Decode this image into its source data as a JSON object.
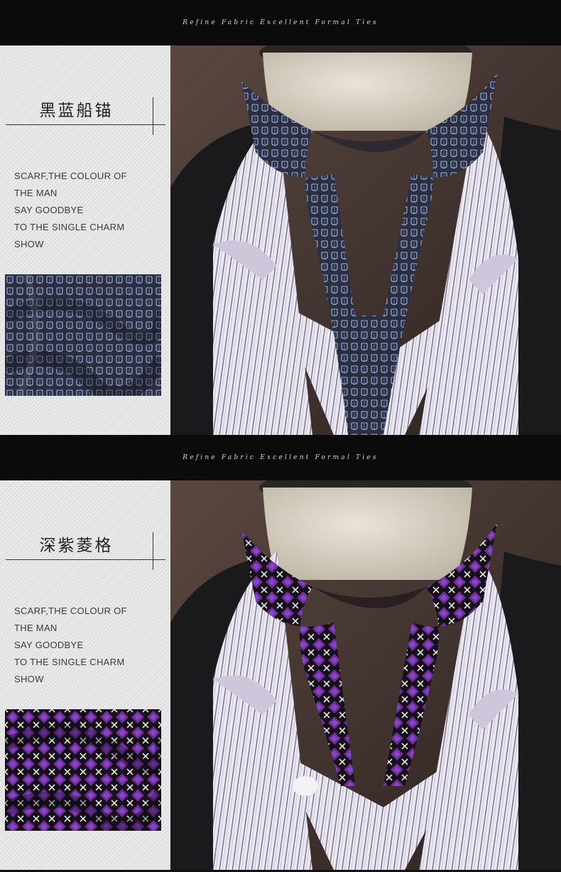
{
  "banner_tagline": "Refine Fabric Excellent Formal Ties",
  "products": [
    {
      "name": "黑蓝船锚",
      "description": [
        "SCARF,THE COLOUR OF",
        "THE MAN",
        "SAY GOODBYE",
        "TO THE SINGLE CHARM",
        "SHOW"
      ],
      "colors": {
        "scarf": "#2a2f44",
        "pattern": "#9fa8c2",
        "accent": "#5c7bd1"
      }
    },
    {
      "name": "深紫菱格",
      "description": [
        "SCARF,THE COLOUR OF",
        "THE MAN",
        "SAY GOODBYE",
        "TO THE SINGLE CHARM",
        "SHOW"
      ],
      "colors": {
        "scarf": "#5a2a86",
        "pattern": "#e8e4ee",
        "accent": "#1b1422"
      }
    }
  ]
}
